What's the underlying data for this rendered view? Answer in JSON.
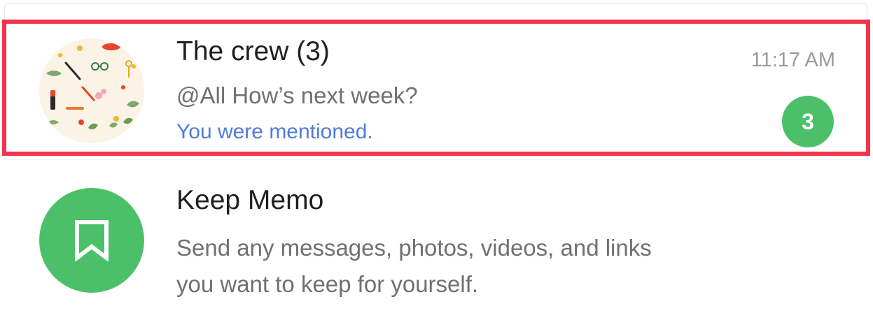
{
  "chats": [
    {
      "name": "The crew (3)",
      "last_message": "@All How’s next week?",
      "mention_note": "You were mentioned.",
      "time": "11:17 AM",
      "unread_count": "3",
      "avatar_icon": "group-illustration-avatar"
    },
    {
      "name": "Keep Memo",
      "description_line1": "Send any messages, photos, videos, and links",
      "description_line2": "you want to keep for yourself.",
      "avatar_icon": "bookmark-icon"
    }
  ],
  "colors": {
    "accent_green": "#4cc068",
    "mention_blue": "#4f7bdc",
    "highlight_red": "#f2344f"
  }
}
